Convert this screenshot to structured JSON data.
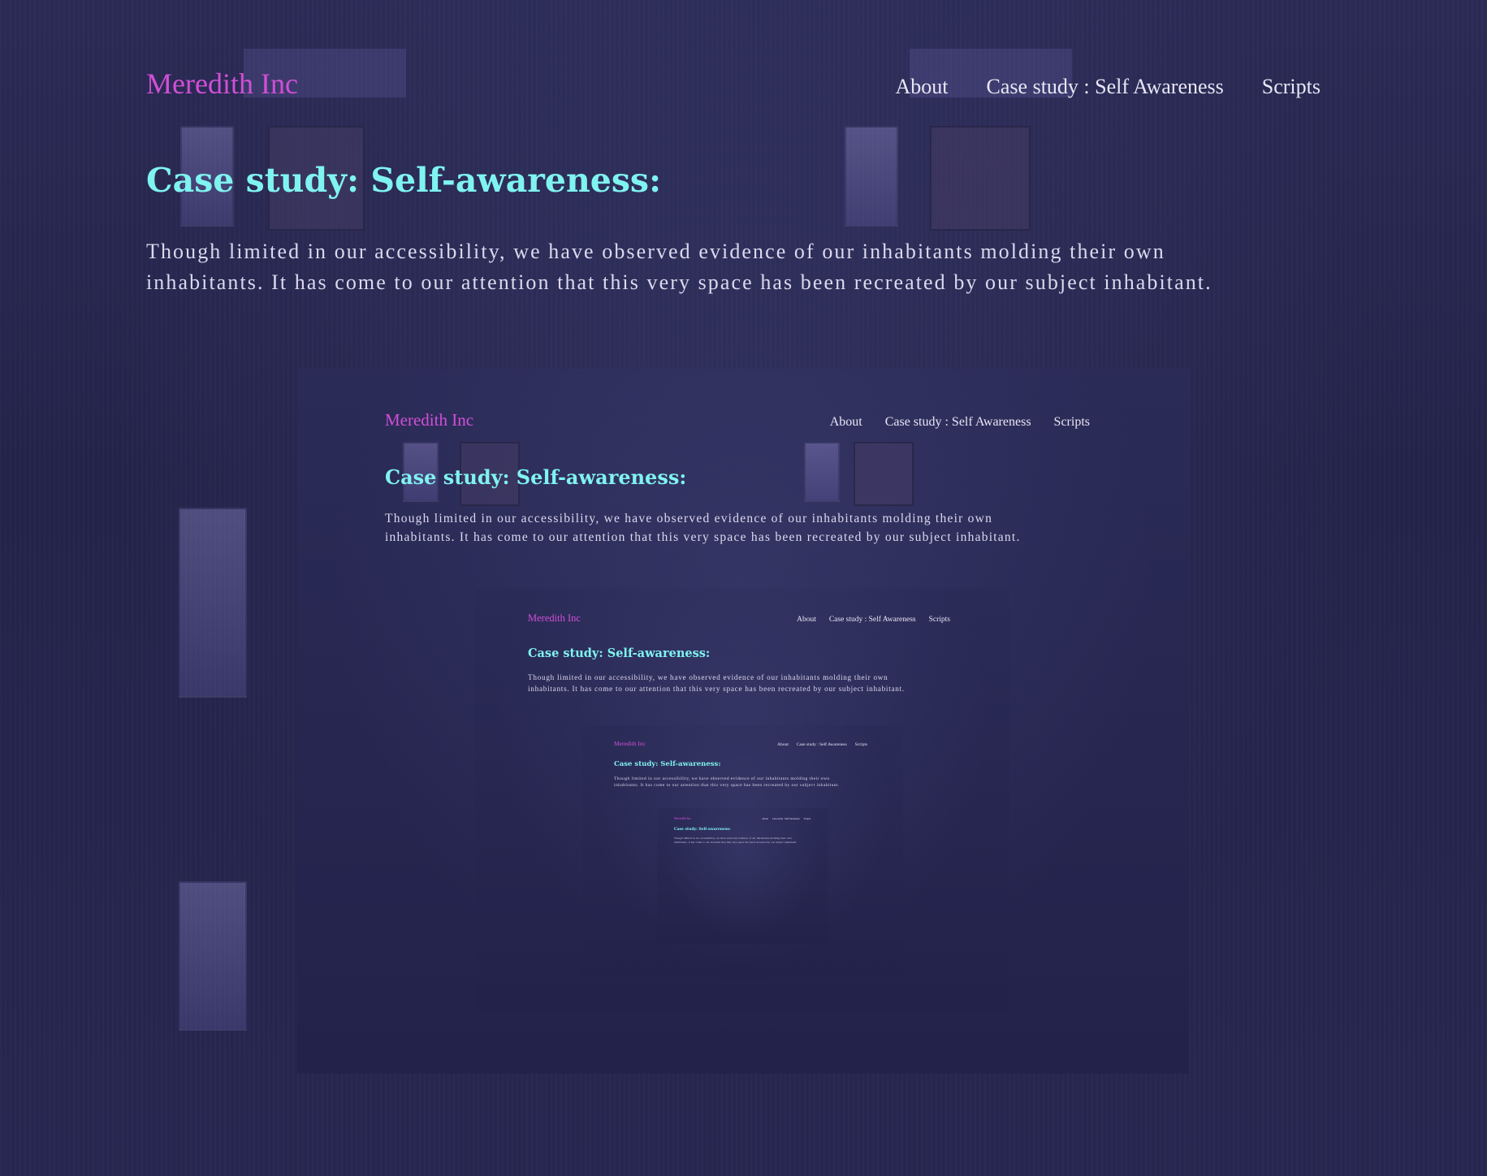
{
  "brand": "Meredith Inc",
  "nav": {
    "about": "About",
    "case_study": "Case study : Self Awareness",
    "scripts": "Scripts"
  },
  "page_title": "Case study: Self-awareness:",
  "intro_line1": "Though limited in our accessibility, we have observed evidence of our inhabitants molding their own",
  "intro_line2": "inhabitants. It has come to our attention that this very space has been recreated by our subject inhabitant.",
  "colors": {
    "brand": "#d14fd6",
    "title": "#7ff3f0",
    "nav_text": "#e9e6f5",
    "background": "#25254a"
  }
}
